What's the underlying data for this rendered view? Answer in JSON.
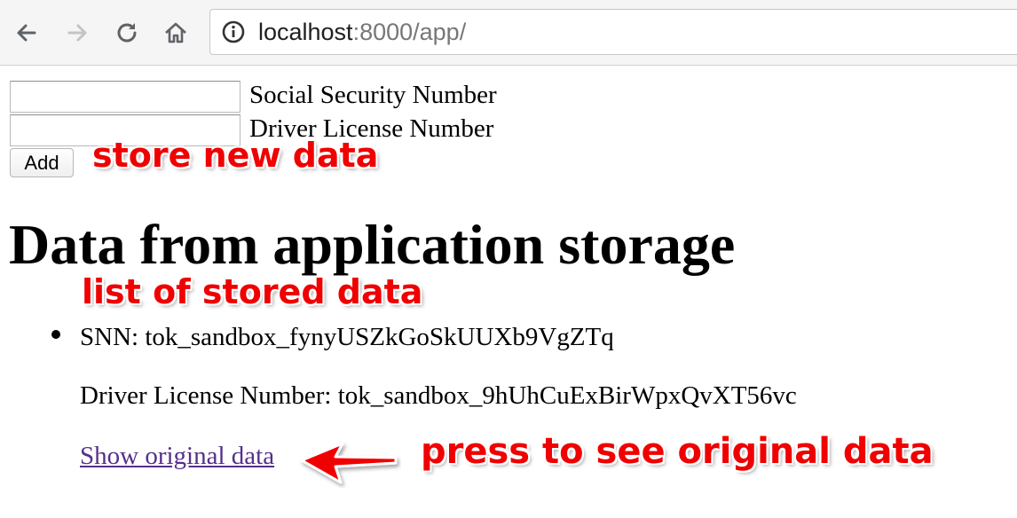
{
  "browser": {
    "url_host": "localhost",
    "url_rest": ":8000/app/",
    "icons": {
      "back": "back-arrow-icon",
      "forward": "forward-arrow-icon",
      "reload": "reload-icon",
      "home": "home-icon",
      "info": "info-icon"
    }
  },
  "form": {
    "ssn_value": "",
    "ssn_label": "Social Security Number",
    "dln_value": "",
    "dln_label": "Driver License Number",
    "add_label": "Add"
  },
  "section": {
    "heading": "Data from application storage"
  },
  "items": [
    {
      "ssn_text": "SNN: tok_sandbox_fynyUSZkGoSkUUXb9VgZTq",
      "dln_text": "Driver License Number: tok_sandbox_9hUhCuExBirWpxQvXT56vc",
      "link_text": "Show original data"
    }
  ],
  "annotations": {
    "store": "store new data",
    "list": "list of stored data",
    "press": "press to see original data",
    "color": "#f00000"
  }
}
